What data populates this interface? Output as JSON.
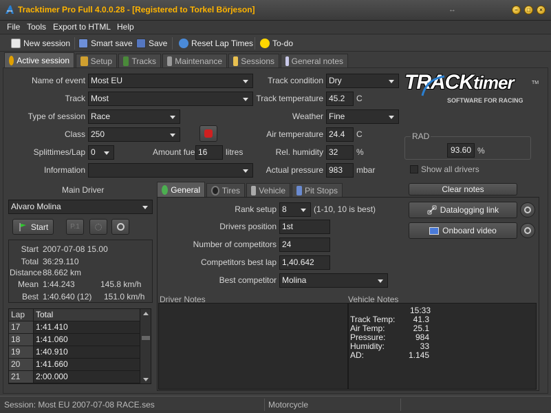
{
  "window": {
    "title": "Tracktimer Pro Full 4.0.0.28  -  [Registered to Torkel Börjeson]"
  },
  "menu": [
    "File",
    "Tools",
    "Export to HTML",
    "Help"
  ],
  "toolbar": {
    "new_session": "New session",
    "smart_save": "Smart save",
    "save": "Save",
    "reset_lap_times": "Reset Lap Times",
    "todo": "To-do"
  },
  "tabs": [
    "Active session",
    "Setup",
    "Tracks",
    "Maintenance",
    "Sessions",
    "General notes"
  ],
  "form": {
    "name_of_event_label": "Name of event",
    "name_of_event": "Most EU",
    "track_label": "Track",
    "track": "Most",
    "type_label": "Type of session",
    "type": "Race",
    "class_label": "Class",
    "class": "250",
    "splittimes_label": "Splittimes/Lap",
    "splittimes": "0",
    "amount_fuel_label": "Amount fuel",
    "amount_fuel": "16",
    "fuel_unit": "litres",
    "information_label": "Information",
    "information": "",
    "track_condition_label": "Track condition",
    "track_condition": "Dry",
    "track_temp_label": "Track temperature",
    "track_temp": "45.2",
    "track_temp_unit": "C",
    "weather_label": "Weather",
    "weather": "Fine",
    "air_temp_label": "Air temperature",
    "air_temp": "24.4",
    "air_temp_unit": "C",
    "humidity_label": "Rel. humidity",
    "humidity": "32",
    "humidity_unit": "%",
    "pressure_label": "Actual pressure",
    "pressure": "983",
    "pressure_unit": "mbar"
  },
  "logo": {
    "text_a": "TRACK",
    "text_b": "timer",
    "tm": "TM",
    "tagline": "SOFTWARE FOR RACING"
  },
  "rad": {
    "label": "RAD",
    "value": "93.60",
    "unit": "%"
  },
  "show_all_drivers": "Show all drivers",
  "clear_notes": "Clear notes",
  "driver": {
    "main_label": "Main Driver",
    "name": "Alvaro Molina",
    "start_btn": "Start",
    "p1_btn": "P.1",
    "stats": {
      "start_label": "Start",
      "start": "2007-07-08 15.00",
      "total_label": "Total",
      "total": "36:29.110",
      "distance_label": "Distance",
      "distance": "88.662 km",
      "mean_label": "Mean",
      "mean": "1:44.243",
      "mean_speed": "145.8 km/h",
      "best_label": "Best",
      "best": "1:40.640 (12)",
      "best_speed": "151.0 km/h"
    }
  },
  "laps": {
    "headers": [
      "Lap",
      "Total"
    ],
    "rows": [
      [
        "17",
        "1:41.410"
      ],
      [
        "18",
        "1:41.060"
      ],
      [
        "19",
        "1:40.910"
      ],
      [
        "20",
        "1:41.660"
      ],
      [
        "21",
        "2:00.000"
      ]
    ]
  },
  "subtabs": [
    "General",
    "Tires",
    "Vehicle",
    "Pit Stops"
  ],
  "general": {
    "rank_setup_label": "Rank setup",
    "rank_setup": "8",
    "rank_hint": "(1-10, 10 is best)",
    "drivers_position_label": "Drivers position",
    "drivers_position": "1st",
    "num_competitors_label": "Number of competitors",
    "num_competitors": "24",
    "competitors_best_label": "Competitors best lap",
    "competitors_best": "1,40.642",
    "best_competitor_label": "Best competitor",
    "best_competitor": "Molina"
  },
  "datalogging_link": "Datalogging link",
  "onboard_video": "Onboard video",
  "notes": {
    "driver_label": "Driver Notes",
    "vehicle_label": "Vehicle Notes",
    "vehicle_time": "15:33",
    "vehicle_lines": [
      [
        "Track Temp:",
        "41.3"
      ],
      [
        "Air Temp:",
        "25.1"
      ],
      [
        "Pressure:",
        "984"
      ],
      [
        "Humidity:",
        "33"
      ],
      [
        "AD:",
        "1.145"
      ]
    ]
  },
  "status": {
    "session": "Session: Most EU 2007-07-08 RACE.ses",
    "vehicle_type": "Motorcycle"
  }
}
